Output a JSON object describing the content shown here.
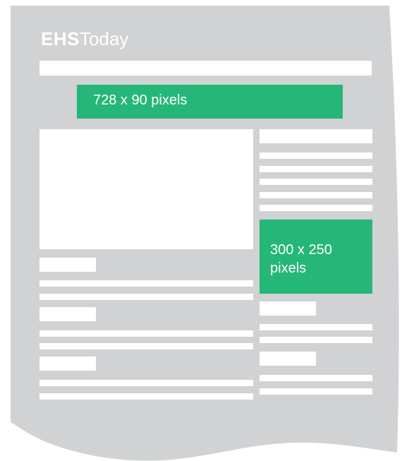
{
  "logo": {
    "bold": "EHS",
    "light": "Today"
  },
  "ads": {
    "leaderboard_label": "728 x 90 pixels",
    "rectangle_label": "300 x 250 pixels"
  },
  "colors": {
    "page": "#d0d2d4",
    "placeholder": "#ffffff",
    "ad": "#25b777"
  }
}
